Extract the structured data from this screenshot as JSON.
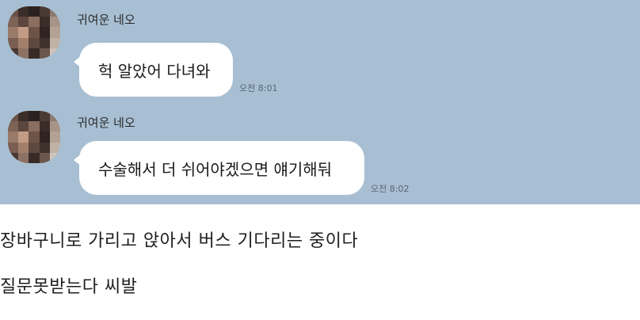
{
  "chat": {
    "background": "#a8bfd3",
    "messages": [
      {
        "sender": "귀여운 네오",
        "text": "헉 알았어 다녀와",
        "time": "오전 8:01"
      },
      {
        "sender": "귀여운 네오",
        "text": "수술해서 더 쉬어야겠으면 얘기해둬",
        "time": "오전 8:02"
      }
    ]
  },
  "post": {
    "lines": [
      "장바구니로 가리고 앉아서 버스 기다리는 중이다",
      "질문못받는다 씨발"
    ]
  }
}
